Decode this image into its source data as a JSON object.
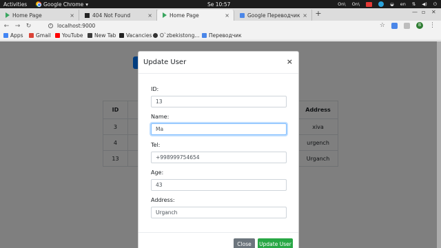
{
  "system": {
    "activities": "Activities",
    "app_name": "Google Chrome",
    "clock": "Se 10:57",
    "tray": [
      "On\\",
      "On\\",
      "en"
    ]
  },
  "tabs": [
    {
      "label": "Home Page",
      "favicon": "play-icon"
    },
    {
      "label": "404 Not Found",
      "favicon": "square-icon"
    },
    {
      "label": "Home Page",
      "favicon": "play-icon"
    },
    {
      "label": "Google Переводчик",
      "favicon": "google-translate-icon"
    }
  ],
  "address": {
    "url": "localhost:9000",
    "profile_initial": "B"
  },
  "bookmarks": [
    {
      "label": "Apps",
      "icon": "apps-grid-icon",
      "color": "#4285f4"
    },
    {
      "label": "Gmail",
      "icon": "gmail-icon",
      "color": "#db4437"
    },
    {
      "label": "YouTube",
      "icon": "youtube-icon",
      "color": "#ff0000"
    },
    {
      "label": "New Tab",
      "icon": "new-tab-icon",
      "color": "#3c3c3c"
    },
    {
      "label": "Vacancies",
      "icon": "hh-icon",
      "color": "#222222"
    },
    {
      "label": "O`zbekistong...",
      "icon": "site-icon",
      "color": "#333333"
    },
    {
      "label": "Переводчик",
      "icon": "translate-icon",
      "color": "#4a86e8"
    }
  ],
  "table": {
    "headers": {
      "id": "ID",
      "address": "Address"
    },
    "rows": [
      {
        "id": "3",
        "address": "xiva"
      },
      {
        "id": "4",
        "address": "urgench"
      },
      {
        "id": "13",
        "address": "Urganch"
      }
    ]
  },
  "modal": {
    "title": "Update User",
    "close_symbol": "×",
    "fields": {
      "id": {
        "label": "ID:",
        "value": "13"
      },
      "name": {
        "label": "Name:",
        "value": "Ma"
      },
      "tel": {
        "label": "Tel:",
        "value": "+998999754654"
      },
      "age": {
        "label": "Age:",
        "value": "43"
      },
      "address": {
        "label": "Address:",
        "value": "Urganch"
      }
    },
    "buttons": {
      "close": "Close",
      "update": "Update User"
    }
  },
  "colors": {
    "primary": "#007bff",
    "success": "#28a745",
    "secondary": "#6c757d"
  }
}
